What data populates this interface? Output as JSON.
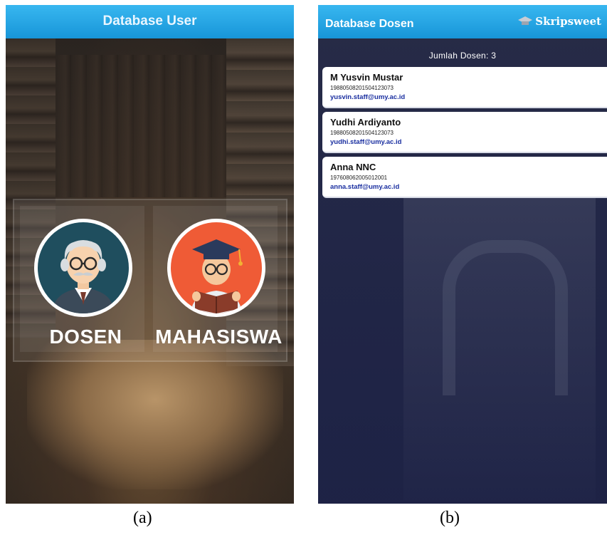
{
  "screen_a": {
    "title": "Database User",
    "menu": [
      {
        "label": "DOSEN",
        "icon": "lecturer-avatar-icon"
      },
      {
        "label": "MAHASISWA",
        "icon": "student-avatar-icon"
      }
    ]
  },
  "screen_b": {
    "title": "Database Dosen",
    "brand": "Skripsweet",
    "count_text": "Jumlah Dosen: 3",
    "lecturers": [
      {
        "name": "M Yusvin Mustar",
        "nip": "19880508201504123073",
        "email": "yusvin.staff@umy.ac.id"
      },
      {
        "name": "Yudhi Ardiyanto",
        "nip": "19880508201504123073",
        "email": "yudhi.staff@umy.ac.id"
      },
      {
        "name": "Anna NNC",
        "nip": "197608062005012001",
        "email": "anna.staff@umy.ac.id"
      }
    ]
  },
  "captions": {
    "a": "(a)",
    "b": "(b)"
  },
  "colors": {
    "appbar": "#1795d8",
    "card_email": "#1a2fa0",
    "dosen_circle": "#1f4e5e",
    "mahasiswa_circle": "#ef5b36"
  }
}
